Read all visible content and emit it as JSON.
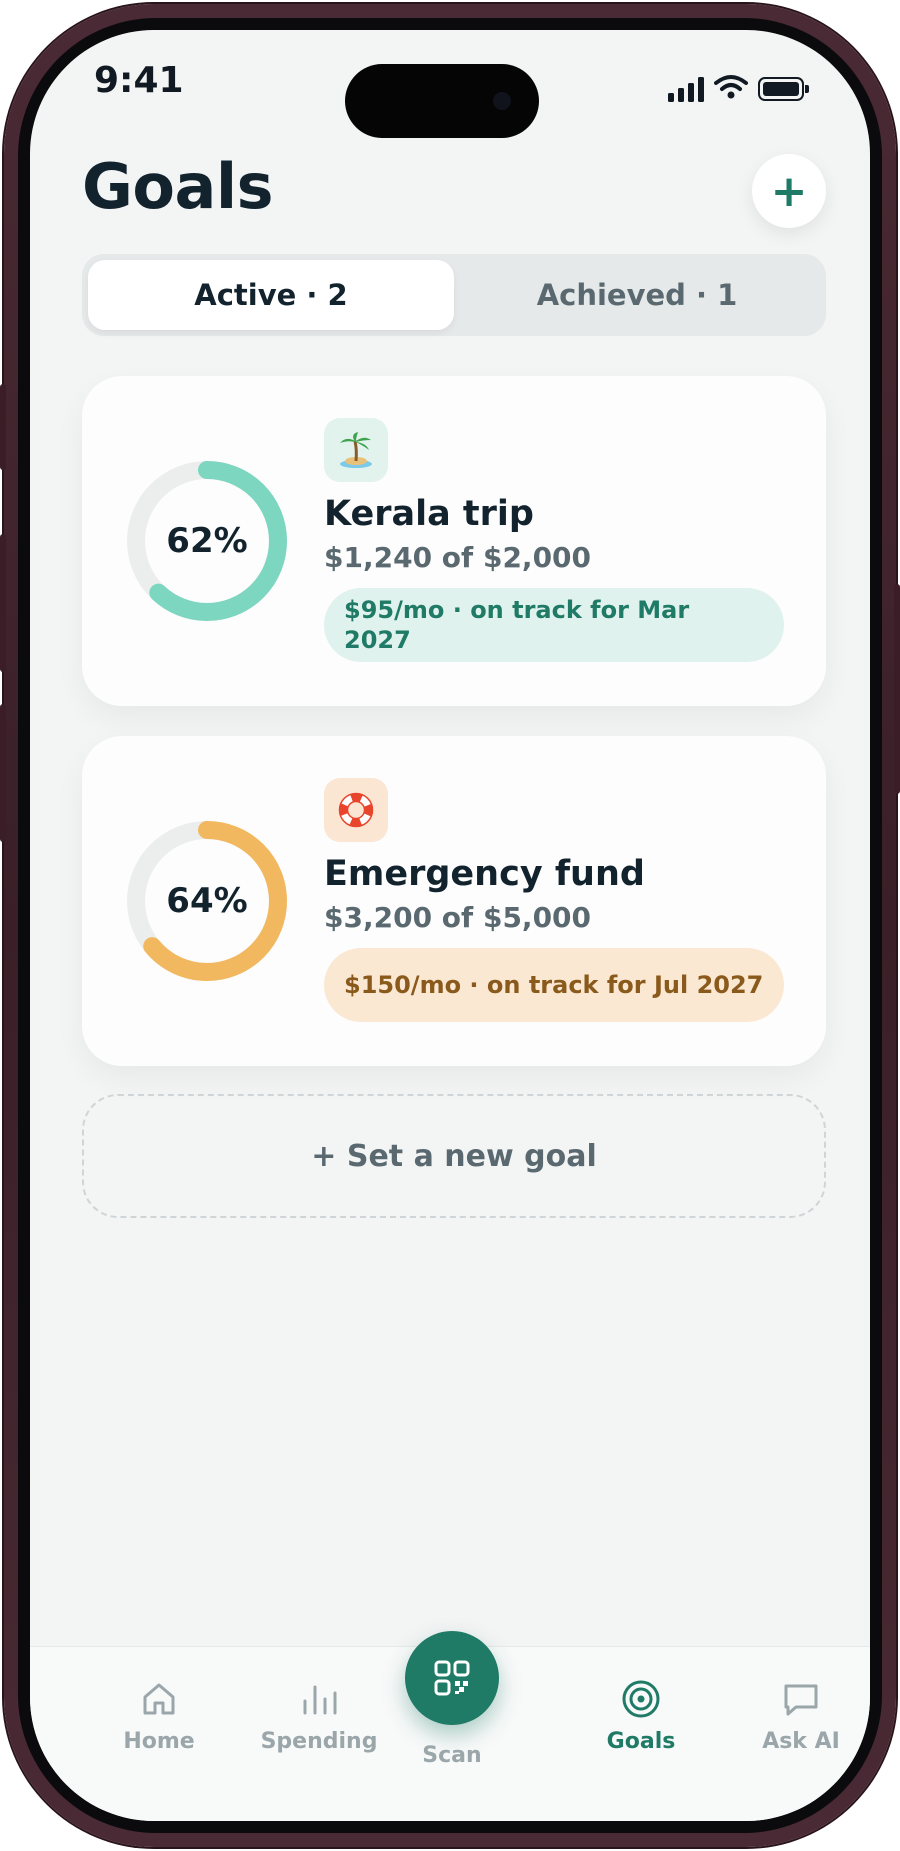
{
  "status_bar": {
    "time": "9:41"
  },
  "header": {
    "title": "Goals",
    "add_label": "+"
  },
  "segments": [
    {
      "label": "Active · 2",
      "selected": true
    },
    {
      "label": "Achieved · 1",
      "selected": false
    }
  ],
  "goals": [
    {
      "icon": "🏝",
      "icon_name": "island-icon",
      "name": "Kerala trip",
      "amount": "$1,240 of $2,000",
      "progress_label": "62%",
      "progress": 0.62,
      "status": "$95/mo · on track for Mar 2027",
      "color": "#7dd6c0",
      "pill_bg": "#e0f2ed",
      "pill_text": "#1f7a66",
      "icon_bg": "#e2f3ee"
    },
    {
      "icon": "🛟",
      "icon_name": "lifebuoy-icon",
      "name": "Emergency fund",
      "amount": "$3,200 of $5,000",
      "progress_label": "64%",
      "progress": 0.64,
      "status": "$150/mo · on track for Jul 2027",
      "color": "#f2b860",
      "pill_bg": "#fbe8d3",
      "pill_text": "#8a5a1c",
      "icon_bg": "#fbe6d4"
    }
  ],
  "new_goal_label": "+ Set a new goal",
  "tabbar": {
    "home": "Home",
    "spending": "Spending",
    "scan": "Scan",
    "goals": "Goals",
    "ask_ai": "Ask AI",
    "active_tab": "Goals"
  },
  "colors": {
    "accent": "#1f7a66",
    "background": "#f3f4f4",
    "text": "#13232e"
  }
}
